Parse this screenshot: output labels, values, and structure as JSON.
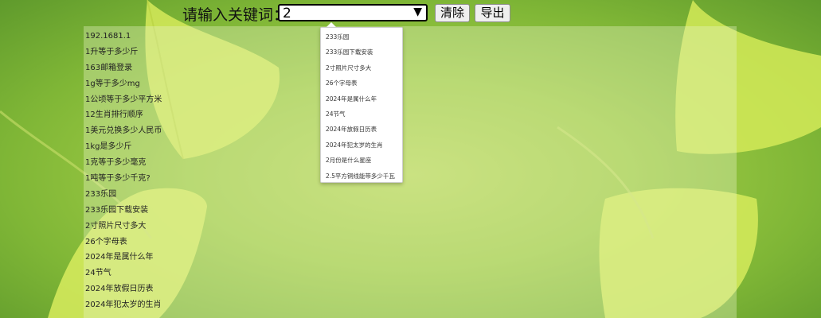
{
  "search": {
    "label": "请输入关键词：",
    "value": "2"
  },
  "buttons": {
    "clear_label": "清除",
    "export_label": "导出"
  },
  "history": [
    "192.1681.1",
    "1升等于多少斤",
    "163邮箱登录",
    "1g等于多少mg",
    "1公顷等于多少平方米",
    "12生肖排行顺序",
    "1美元兑换多少人民币",
    "1kg是多少斤",
    "1克等于多少毫克",
    "1吨等于多少千克?",
    "233乐园",
    "233乐园下载安装",
    "2寸照片尺寸多大",
    "26个字母表",
    "2024年是属什么年",
    "24节气",
    "2024年放假日历表",
    "2024年犯太岁的生肖"
  ],
  "suggestions": [
    "233乐园",
    "233乐园下载安装",
    "2寸照片尺寸多大",
    "26个字母表",
    "2024年是属什么年",
    "24节气",
    "2024年放假日历表",
    "2024年犯太岁的生肖",
    "2月份是什么星座",
    "2.5平方铜线能带多少千瓦"
  ],
  "colors": {
    "background": "#9fcb45",
    "leaf": "#d6ea5a"
  },
  "icons": {
    "dropdown": "triangle-down"
  }
}
